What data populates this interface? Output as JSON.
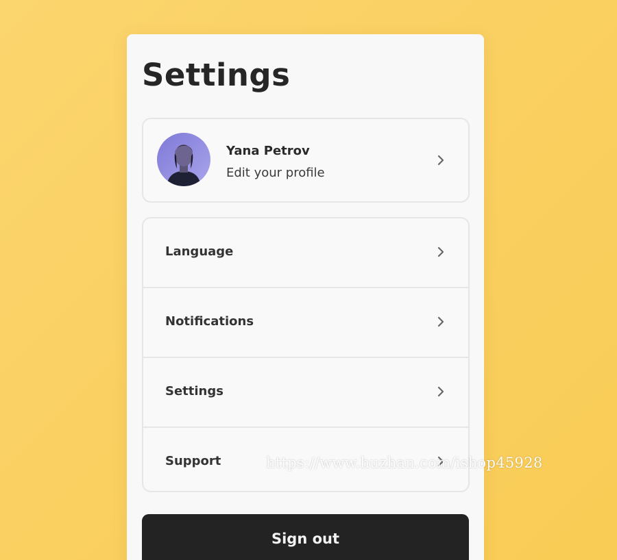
{
  "page": {
    "title": "Settings"
  },
  "profile": {
    "name": "Yana Petrov",
    "subtitle": "Edit your profile",
    "avatar_icon": "user-photo",
    "chevron_icon": "chevron-right-icon"
  },
  "menu": {
    "items": [
      {
        "label": "Language",
        "icon": "chevron-right-icon"
      },
      {
        "label": "Notifications",
        "icon": "chevron-right-icon"
      },
      {
        "label": "Settings",
        "icon": "chevron-right-icon"
      },
      {
        "label": "Support",
        "icon": "chevron-right-icon"
      }
    ]
  },
  "actions": {
    "sign_out_label": "Sign out"
  },
  "overlay": {
    "watermark_text": "https://www.huzhan.com/ishop45928"
  },
  "colors": {
    "background": "#fad062",
    "panel": "#f8f8f8",
    "button": "#232323",
    "border": "#e6e6e6"
  }
}
